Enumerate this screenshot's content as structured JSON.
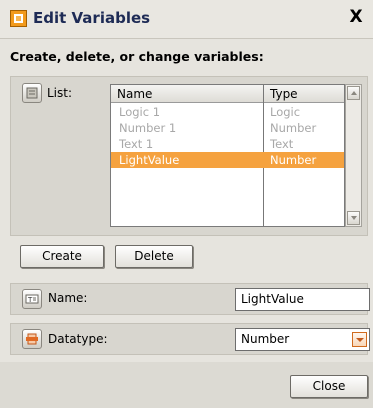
{
  "window": {
    "title": "Edit Variables",
    "close_glyph": "X"
  },
  "heading": "Create, delete, or change variables:",
  "list_section": {
    "label": "List:",
    "icon": "list-icon",
    "columns": [
      "Name",
      "Type"
    ],
    "rows": [
      {
        "name": "Logic 1",
        "type": "Logic",
        "state": "dim"
      },
      {
        "name": "Number 1",
        "type": "Number",
        "state": "dim"
      },
      {
        "name": "Text 1",
        "type": "Text",
        "state": "dim"
      },
      {
        "name": "LightValue",
        "type": "Number",
        "state": "selected"
      }
    ]
  },
  "buttons": {
    "create": "Create",
    "delete": "Delete",
    "close": "Close"
  },
  "name_field": {
    "label": "Name:",
    "value": "LightValue",
    "icon": "text-field-icon"
  },
  "datatype_field": {
    "label": "Datatype:",
    "value": "Number",
    "icon": "datatype-icon"
  },
  "colors": {
    "selection": "#f5a23f",
    "title_text": "#1e2b55",
    "accent": "#f29a1c"
  }
}
